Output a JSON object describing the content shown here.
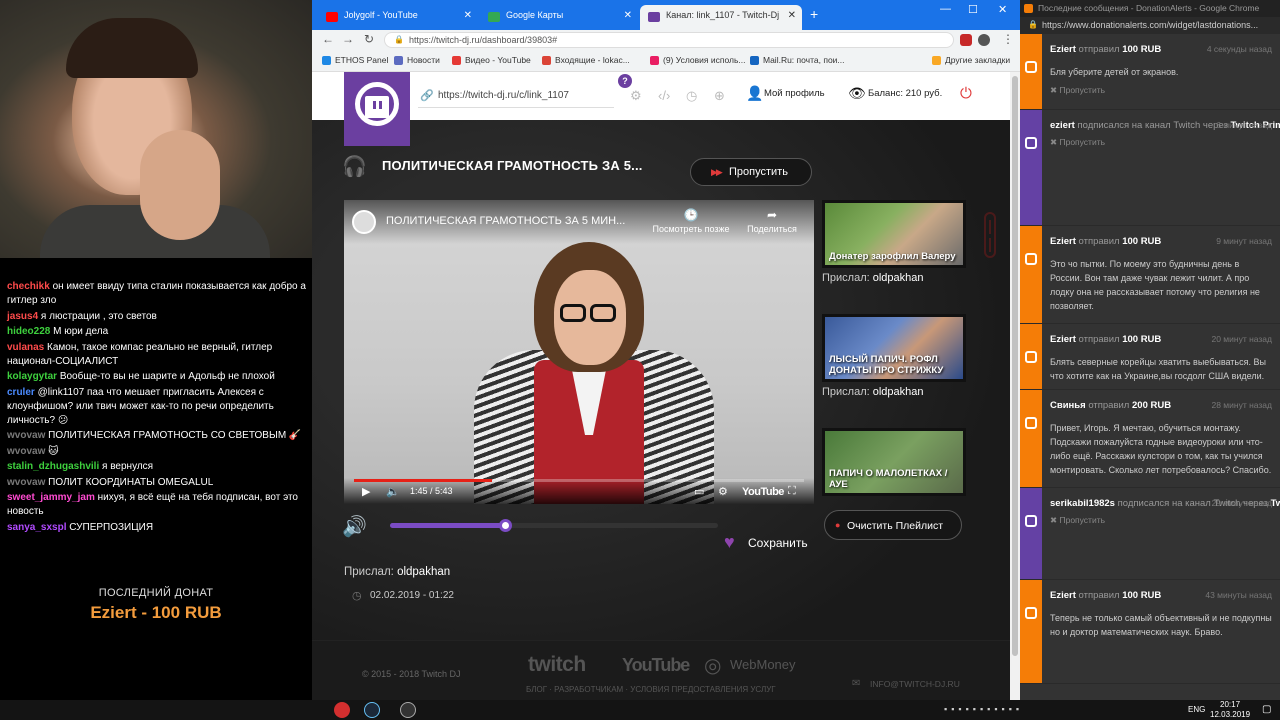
{
  "browser": {
    "tabs": [
      {
        "label": "Jolygolf - YouTube",
        "color": "#ff0000"
      },
      {
        "label": "Google Карты",
        "color": "#34a853"
      },
      {
        "label": "Канал: link_1107 - Twitch-Dj",
        "color": "#6b3fa0"
      }
    ],
    "url": "https://twitch-dj.ru/dashboard/39803#",
    "bookmarks": [
      "ETHOS Panel",
      "Новости",
      "Видео - YouTube",
      "Входящие - lokac...",
      "(9) Условия исполь...",
      "Mail.Ru: почта, пои...",
      "Другие закладки"
    ]
  },
  "chat": {
    "messages": [
      {
        "user": "chechikk",
        "color": "#ff4b4b",
        "text": "он имеет ввиду типа сталин показывается как добро а гитлер зло"
      },
      {
        "user": "jasus4",
        "color": "#ff4b4b",
        "text": "я люстрации , это светов"
      },
      {
        "user": "hideo228",
        "color": "#3ed13e",
        "text": "М юри дела"
      },
      {
        "user": "vulanas",
        "color": "#ff4b4b",
        "text": "Камон, такое компас реально не верный, гитлер национал-СОЦИАЛИСТ"
      },
      {
        "user": "kolaygytar",
        "color": "#3ed13e",
        "text": "Вообще-то вы не шарите и Адольф не плохой"
      },
      {
        "user": "cruler",
        "color": "#4b8bff",
        "text": "@link1107 паа что мешает пригласить Алексея с клоунфишом? или твич может как-то по речи определить личность? 😕"
      },
      {
        "user": "wvovaw",
        "color": "#7a7a7a",
        "text": "ПОЛИТИЧЕСКАЯ ГРАМОТНОСТЬ СО СВЕТОВЫМ 🎸"
      },
      {
        "user": "wvovaw",
        "color": "#7a7a7a",
        "text": "🐱"
      },
      {
        "user": "stalin_dzhugashvili",
        "color": "#3ed13e",
        "text": "я вернулся"
      },
      {
        "user": "wvovaw",
        "color": "#7a7a7a",
        "text": "ПОЛИТ КООРДИНАТЫ OMEGALUL"
      },
      {
        "user": "sweet_jammy_jam",
        "color": "#ff4bd1",
        "text": "нихуя, я всё ещё на тебя подписан, вот это новость"
      },
      {
        "user": "sanya_sxspl",
        "color": "#b24bff",
        "text": "СУПЕРПОЗИЦИЯ"
      }
    ],
    "last_donation_label": "ПОСЛЕДНИЙ ДОНАТ",
    "last_donation_value": "Eziert - 100 RUB"
  },
  "site": {
    "url_field": "https://twitch-dj.ru/c/link_1107",
    "help": "?",
    "profile": "Мой профиль",
    "balance": "Баланс: 210 руб.",
    "now_playing": "ПОЛИТИЧЕСКАЯ ГРАМОТНОСТЬ ЗА 5...",
    "skip": "Пропустить",
    "video": {
      "title": "ПОЛИТИЧЕСКАЯ ГРАМОТНОСТЬ ЗА 5 МИН...",
      "watch_later": "Посмотреть позже",
      "share": "Поделиться",
      "time": "1:45 / 5:43",
      "progress": 0.306,
      "brand": "YouTube"
    },
    "volume": 0.35,
    "save": "Сохранить",
    "sender_label": "Прислал:",
    "sender_name": "oldpakhan",
    "date": "02.02.2019 - 01:22",
    "queue": [
      {
        "caption": "Донатер зарофлил Валеру",
        "from": "oldpakhan"
      },
      {
        "caption": "ЛЫСЫЙ ПАПИЧ. РОФЛ ДОНАТЫ ПРО СТРИЖКУ",
        "from": "oldpakhan"
      },
      {
        "caption": "ПАПИЧ О МАЛОЛЕТКАХ / АУЕ",
        "from": ""
      }
    ],
    "clear": "Очистить Плейлист",
    "footer": {
      "copyright": "© 2015 - 2018 Twitch DJ",
      "twitch": "twitch",
      "youtube": "YouTube",
      "webmoney": "WebMoney",
      "links": "БЛОГ · РАЗРАБОТЧИКАМ · УСЛОВИЯ ПРЕДОСТАВЛЕНИЯ УСЛУГ",
      "email": "INFO@TWITCH-DJ.RU"
    }
  },
  "donations": {
    "title": "Последние сообщения - DonationAlerts - Google Chrome",
    "url": "https://www.donationalerts.com/widget/lastdonations...",
    "items": [
      {
        "kind": "donation",
        "user": "Eziert",
        "action": "отправил",
        "amount": "100 RUB",
        "time": "4 секунды назад",
        "message": "Бля уберите детей от экранов.",
        "skip": "Пропустить",
        "color": "#f57d07"
      },
      {
        "kind": "sub",
        "user": "eziert",
        "action": "подписался на канал Twitch через",
        "amount": "Twitch Prime!",
        "time": "6 минут назад",
        "message": "",
        "skip": "Пропустить",
        "color": "#6441a4"
      },
      {
        "kind": "donation",
        "user": "Eziert",
        "action": "отправил",
        "amount": "100 RUB",
        "time": "9 минут назад",
        "message": "Это чо пытки. По моему это будничны день в России. Вон там даже чувак лежит чилит. А про лодку она не рассказывает потому что религия не позволяет.",
        "skip": "",
        "color": "#f57d07"
      },
      {
        "kind": "donation",
        "user": "Eziert",
        "action": "отправил",
        "amount": "100 RUB",
        "time": "20 минут назад",
        "message": "Блять северные корейцы хватить выебываться. Вы что хотите как на Украине,вы госдолг США видели.",
        "skip": "",
        "color": "#f57d07"
      },
      {
        "kind": "donation",
        "user": "Свинья",
        "action": "отправил",
        "amount": "200 RUB",
        "time": "28 минут назад",
        "message": "Привет, Игорь. Я мечтаю, обучиться монтажу. Подскажи пожалуйста годные видеоуроки или что-либо ещё. Расскажи кулстори о том, как ты учился монтировать. Сколько лет потребовалось? Спасибо.",
        "skip": "",
        "color": "#f57d07"
      },
      {
        "kind": "sub",
        "user": "serikabil1982s",
        "action": "подписался на канал Twitch через",
        "amount": "Twitch Prime!",
        "time": "29 минут назад",
        "message": "",
        "skip": "Пропустить",
        "color": "#6441a4"
      },
      {
        "kind": "donation",
        "user": "Eziert",
        "action": "отправил",
        "amount": "100 RUB",
        "time": "43 минуты назад",
        "message": "Теперь не только самый объективный и не подкупны но и доктор математических наук. Браво.",
        "skip": "",
        "color": "#f57d07"
      }
    ]
  },
  "taskbar": {
    "lang": "ENG",
    "time": "20:17",
    "date": "12.03.2019"
  }
}
